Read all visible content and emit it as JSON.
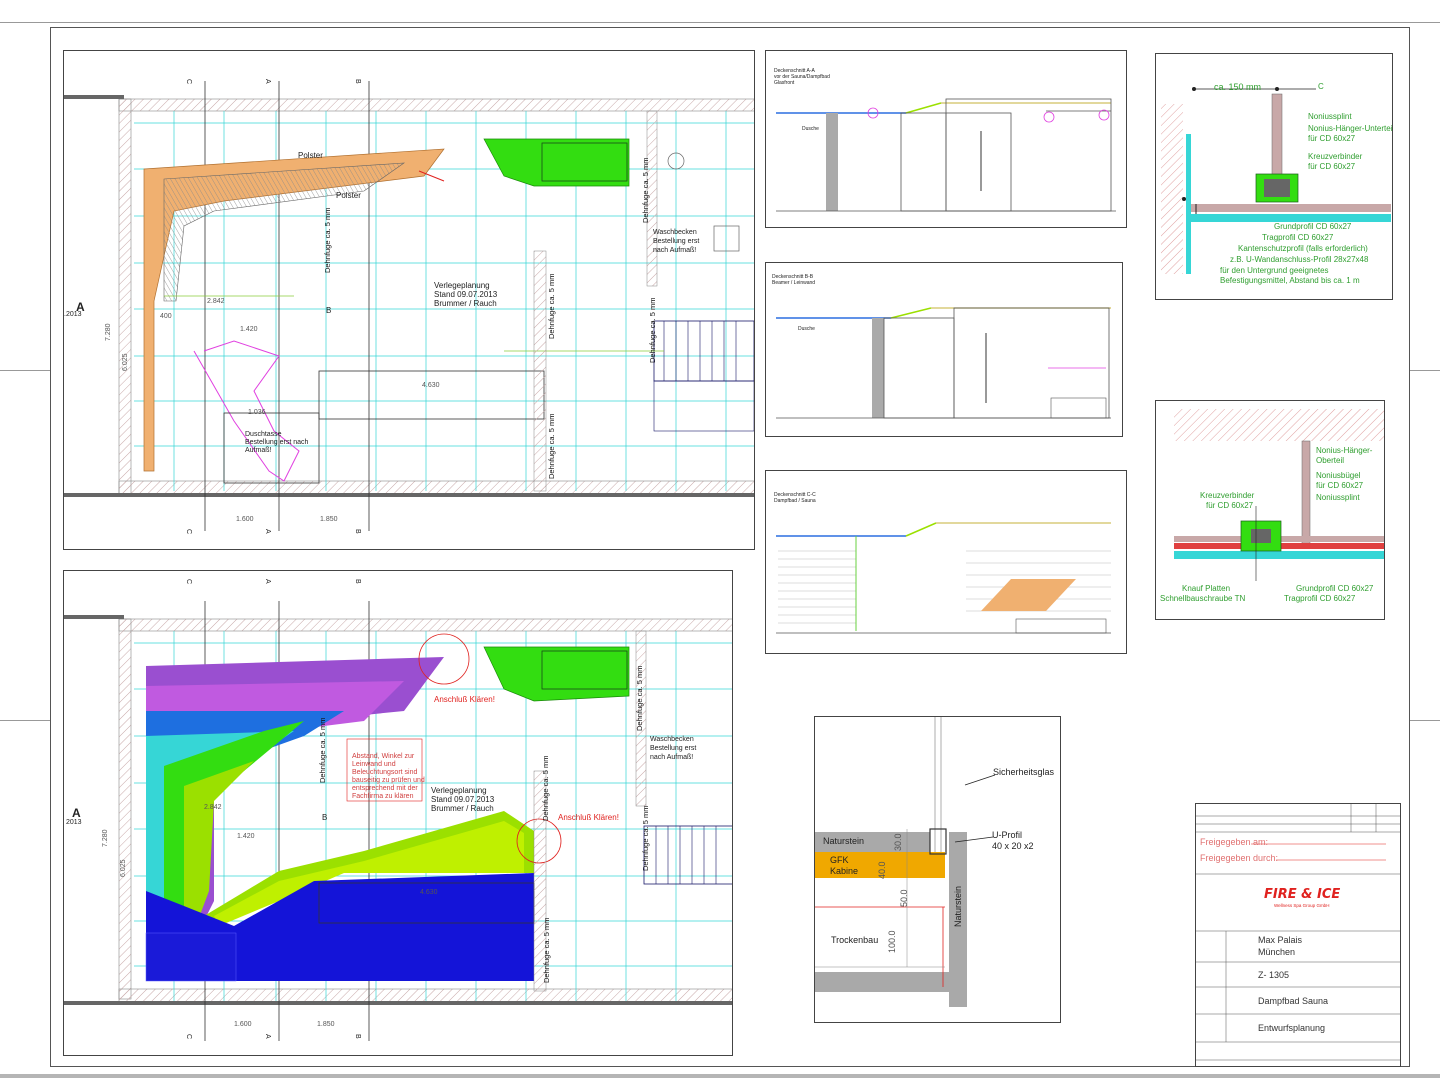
{
  "plan_top": {
    "section_letters": [
      "C",
      "A",
      "B",
      "C",
      "A",
      "B"
    ],
    "marker_a_left": "A",
    "marker_a_date": ".2013",
    "mid_b": "B",
    "polster_1": "Polster",
    "polster_2": "Polster",
    "dehnfuge_vertical_1": "Dehnfuge ca. 5 mm",
    "dehnfuge_vertical_2": "Dehnfuge ca. 5 mm",
    "dehnfuge_vertical_3": "Dehnfuge ca. 5 mm",
    "dehnfuge_vertical_4": "Dehnfuge ca. 5 mm",
    "dehnfuge_vertical_5": "Dehnfuge ca. 5 mm",
    "planning_line1": "Verlegeplanung",
    "planning_line2": "Stand 09.07.2013",
    "planning_line3": "Brummer / Rauch",
    "waschbecken_line1": "Waschbecken",
    "waschbecken_line2": "Bestellung erst",
    "waschbecken_line3": "nach Aufmaß!",
    "dusch_line1": "Duschtasse",
    "dusch_line2": "Bestellung erst nach",
    "dusch_line3": "Aufmaß!",
    "dim_1": "1.420",
    "dim_2": "2.842",
    "dim_3": "1.036",
    "dim_4": "1.600",
    "dim_5": "1.850",
    "dim_6": "4.630",
    "dim_7": "7.280",
    "dim_8": "6.025",
    "dim_9": "400"
  },
  "plan_bottom": {
    "section_letters": [
      "C",
      "A",
      "B",
      "C",
      "A",
      "B"
    ],
    "marker_a": "A",
    "marker_a_date": "2013",
    "mid_b": "B",
    "anschluss_1": "Anschluß Klären!",
    "anschluss_2": "Anschluß Klären!",
    "dehnfuge_vertical_1": "Dehnfuge ca. 5 mm",
    "dehnfuge_vertical_2": "Dehnfuge ca. 5 mm",
    "dehnfuge_vertical_3": "Dehnfuge ca. 5 mm",
    "dehnfuge_vertical_4": "Dehnfuge ca. 5 mm",
    "dehnfuge_vertical_5": "Dehnfuge ca. 5 mm",
    "abstand_line1": "Abstand, Winkel zur",
    "abstand_line2": "Leinwand und",
    "abstand_line3": "Beleuchtungsort sind",
    "abstand_line4": "bauseitig zu prüfen und",
    "abstand_line5": "entsprechend mit der",
    "abstand_line6": "Fachfirma zu klären",
    "planning_line1": "Verlegeplanung",
    "planning_line2": "Stand 09.07.2013",
    "planning_line3": "Brummer / Rauch",
    "waschbecken_line1": "Waschbecken",
    "waschbecken_line2": "Bestellung erst",
    "waschbecken_line3": "nach Aufmaß!",
    "dim_1": "1.420",
    "dim_2": "2.842",
    "dim_3": "1.600",
    "dim_4": "1.850",
    "dim_5": "4.630",
    "dim_6": "7.280",
    "dim_7": "6.025"
  },
  "sections": {
    "aa_title_1": "Deckenschnitt A-A",
    "aa_title_2": "vor der Sauna/Dampfbad",
    "aa_title_3": "Glasfront",
    "aa_dusche": "Dusche",
    "bb_title_1": "Deckenschnitt B-B",
    "bb_title_2": "Beamer / Leinwand",
    "bb_dusche": "Dusche",
    "cc_title_1": "Deckenschnitt C-C",
    "cc_title_2": "Dampfbad / Sauna"
  },
  "detail_top": {
    "dim_label": "ca. 150 mm",
    "mark_c": "C",
    "nonius_splint": "Noniussplint",
    "nonius_unterteil_1": "Nonius-Hänger-Unterteil",
    "nonius_unterteil_2": "für CD 60x27",
    "kreuz_1": "Kreuzverbinder",
    "kreuz_2": "für CD 60x27",
    "grund": "Grundprofil CD 60x27",
    "trag": "Tragprofil CD 60x27",
    "kanten": "Kantenschutzprofil (falls erforderlich)",
    "uwand": "z.B. U-Wandanschluss-Profil 28x27x48",
    "untergrund": "für den Untergrund geeignetes",
    "befestigung": "Befestigungsmittel, Abstand bis ca. 1 m"
  },
  "detail_bottom": {
    "oberteil_1": "Nonius-Hänger-",
    "oberteil_2": "Oberteil",
    "buegel_1": "Noniusbügel",
    "buegel_2": "für CD 60x27",
    "splint": "Noniussplint",
    "kreuz_1": "Kreuzverbinder",
    "kreuz_2": "für CD 60x27",
    "knauf_1": "Knauf Platten",
    "knauf_2": "Schnellbauschraube TN",
    "grund": "Grundprofil CD 60x27",
    "trag": "Tragprofil CD 60x27"
  },
  "detail_glass": {
    "sicherheitsglas": "Sicherheitsglas",
    "uprofil_1": "U-Profil",
    "uprofil_2": "40 x 20 x2",
    "naturstein": "Naturstein",
    "naturstein_v": "Naturstein",
    "gfk_1": "GFK",
    "gfk_2": "Kabine",
    "trockenbau": "Trockenbau",
    "dim_30": "30.0",
    "dim_40": "40.0",
    "dim_50": "50.0",
    "dim_100": "100.0"
  },
  "title_block": {
    "freigegeben_am": "Freigegeben am:",
    "freigegeben_durch": "Freigegeben durch:",
    "brand": "FIRE & ICE",
    "brand_sub": "Wellness Spa Group GmbH",
    "project_1": "Max Palais",
    "project_2": "München",
    "number": "Z- 1305",
    "content": "Dampfbad Sauna",
    "phase": "Entwurfsplanung"
  },
  "colors": {
    "wall_hatch": "#c8a8a8",
    "orange_bench": "#f0b070",
    "green_fill": "#33dd11",
    "cyan_grid": "#36d6d6",
    "magenta": "#e040e0",
    "violet": "#9a4fd0",
    "blue": "#1e6fe0",
    "deep_blue": "#1414d8",
    "lime": "#bff000",
    "yellow_green": "#9be000",
    "red": "#e0221f",
    "gfk_orange": "#f0a800",
    "stone_grey": "#a9a9a9"
  }
}
